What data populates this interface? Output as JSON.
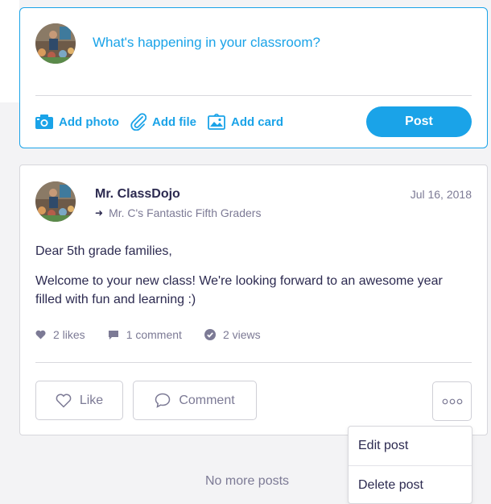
{
  "composer": {
    "prompt": "What's happening in your classroom?",
    "actions": [
      {
        "label": "Add photo",
        "icon": "camera-icon"
      },
      {
        "label": "Add file",
        "icon": "paperclip-icon"
      },
      {
        "label": "Add card",
        "icon": "card-icon"
      }
    ],
    "post_label": "Post"
  },
  "story": {
    "author": "Mr. ClassDojo",
    "class_name": "Mr. C's Fantastic Fifth Graders",
    "date": "Jul 16, 2018",
    "body": [
      "Dear 5th grade families,",
      "Welcome to your new class! We're looking forward to an awesome year filled with fun and learning :)"
    ],
    "stats": {
      "likes": "2 likes",
      "comments": "1 comment",
      "views": "2 views"
    },
    "like_label": "Like",
    "comment_label": "Comment"
  },
  "menu": {
    "edit_label": "Edit post",
    "delete_label": "Delete post"
  },
  "footer": {
    "no_more": "No more posts"
  },
  "colors": {
    "accent": "#1aa3e8",
    "text": "#2c2a50",
    "muted": "#7c7a95",
    "background": "#f3f3f5"
  }
}
